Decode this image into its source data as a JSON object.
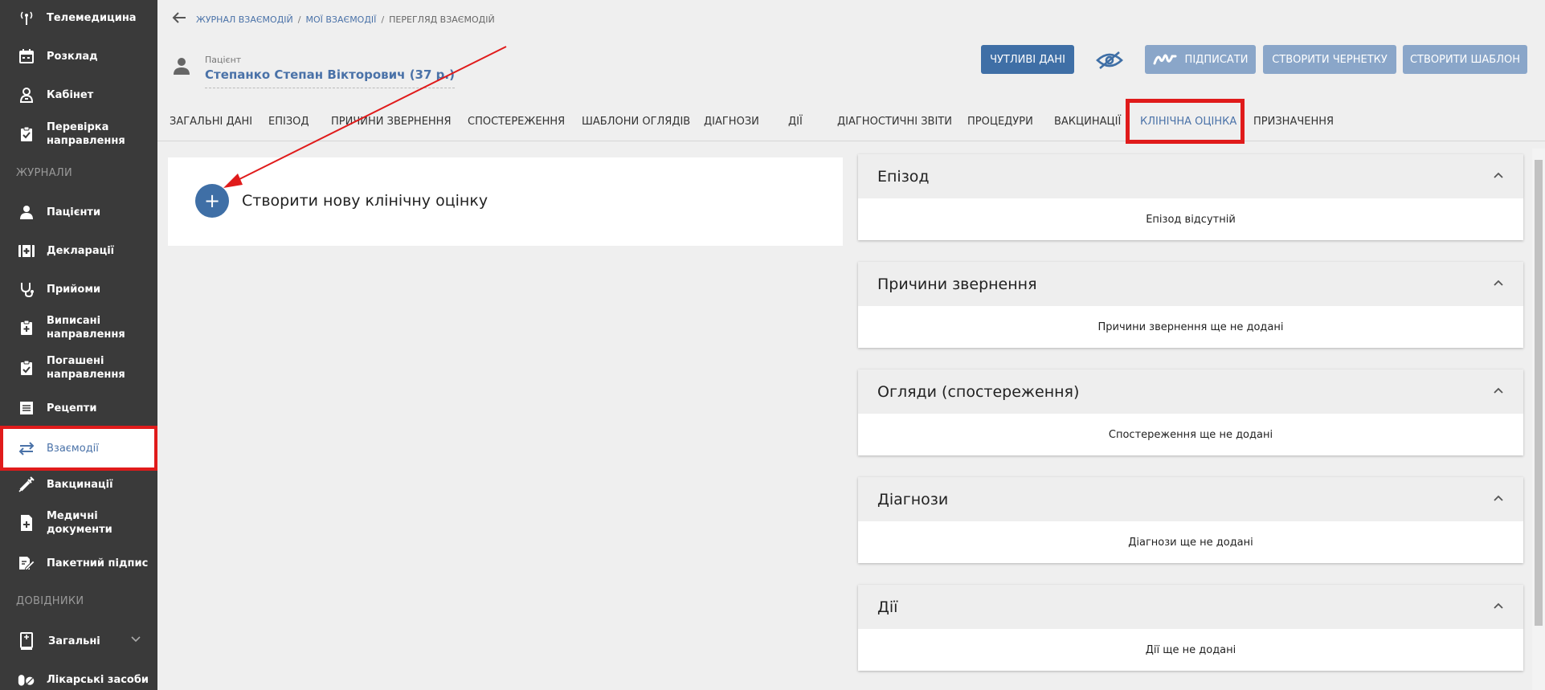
{
  "sidebar": {
    "items": [
      {
        "label": "Телемедицина",
        "icon": "antenna-icon"
      },
      {
        "label": "Розклад",
        "icon": "calendar-icon"
      },
      {
        "label": "Кабінет",
        "icon": "doctor-icon"
      },
      {
        "label": "Перевірка направлення",
        "icon": "clipboard-check-icon"
      },
      {
        "label": "Пацієнти",
        "icon": "person-icon"
      },
      {
        "label": "Декларації",
        "icon": "medical-case-icon"
      },
      {
        "label": "Прийоми",
        "icon": "stethoscope-icon"
      },
      {
        "label": "Виписані направлення",
        "icon": "clipboard-plus-icon"
      },
      {
        "label": "Погашені направлення",
        "icon": "clipboard-done-icon"
      },
      {
        "label": "Рецепти",
        "icon": "list-icon"
      },
      {
        "label": "Взаємодії",
        "icon": "swap-arrows-icon"
      },
      {
        "label": "Вакцинації",
        "icon": "syringe-icon"
      },
      {
        "label": "Медичні документи",
        "icon": "document-plus-icon"
      },
      {
        "label": "Пакетний підпис",
        "icon": "sign-icon"
      },
      {
        "label": "Загальні",
        "icon": "book-icon"
      },
      {
        "label": "Лікарські засоби",
        "icon": "pills-icon"
      }
    ],
    "sections": {
      "journals": "ЖУРНАЛИ",
      "references": "ДОВІДНИКИ"
    }
  },
  "breadcrumb": {
    "items": [
      "ЖУРНАЛ ВЗАЄМОДІЙ",
      "МОЇ ВЗАЄМОДІЇ",
      "ПЕРЕГЛЯД ВЗАЄМОДІЙ"
    ],
    "separator": "/"
  },
  "patient": {
    "label": "Пацієнт",
    "name": "Степанко Степан Вікторович (37 р.)"
  },
  "header_buttons": {
    "sensitive": "ЧУТЛИВІ ДАНІ",
    "sign": "ПІДПИСАТИ",
    "draft": "СТВОРИТИ ЧЕРНЕТКУ",
    "template": "СТВОРИТИ ШАБЛОН"
  },
  "tabs": [
    "ЗАГАЛЬНІ ДАНІ",
    "ЕПІЗОД",
    "ПРИЧИНИ ЗВЕРНЕННЯ",
    "СПОСТЕРЕЖЕННЯ",
    "ШАБЛОНИ ОГЛЯДІВ",
    "ДІАГНОЗИ",
    "ДІЇ",
    "ДІАГНОСТИЧНІ ЗВІТИ",
    "ПРОЦЕДУРИ",
    "ВАКЦИНАЦІЇ",
    "КЛІНІЧНА ОЦІНКА",
    "ПРИЗНАЧЕННЯ"
  ],
  "active_tab": "КЛІНІЧНА ОЦІНКА",
  "create": {
    "label": "Створити нову клінічну оцінку",
    "button": "+"
  },
  "accordion": [
    {
      "title": "Епізод",
      "body": "Епізод відсутній"
    },
    {
      "title": "Причини звернення",
      "body": "Причини звернення ще не додані"
    },
    {
      "title": "Огляди (спостереження)",
      "body": "Спостереження ще не додані"
    },
    {
      "title": "Діагнози",
      "body": "Діагнози ще не додані"
    },
    {
      "title": "Дії",
      "body": "Дії ще не додані"
    }
  ],
  "colors": {
    "accent": "#3f6fa6",
    "sidebar": "#3a3a3a",
    "highlight": "#e01b1b"
  }
}
